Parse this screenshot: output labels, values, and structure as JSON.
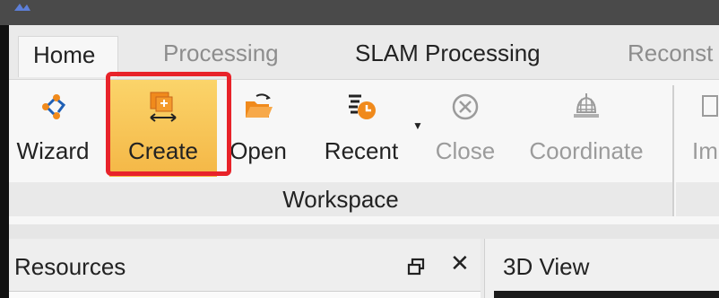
{
  "tabs": [
    {
      "label": "Home",
      "state": "active"
    },
    {
      "label": "Processing",
      "state": "disabled"
    },
    {
      "label": "SLAM Processing",
      "state": "normal"
    },
    {
      "label": "Reconst",
      "state": "disabled"
    }
  ],
  "ribbon": {
    "buttons": {
      "wizard": "Wizard",
      "create": "Create",
      "open": "Open",
      "recent": "Recent",
      "close": "Close",
      "coordinate": "Coordinate",
      "im": "Im"
    },
    "group_label": "Workspace"
  },
  "panels": {
    "resources": {
      "title": "Resources"
    },
    "view3d": {
      "title": "3D View"
    }
  },
  "colors": {
    "highlight_border": "#e8232a",
    "create_fill": "#f4b746",
    "icon_orange": "#f08a1c",
    "disabled_text": "#9b9b9b"
  }
}
